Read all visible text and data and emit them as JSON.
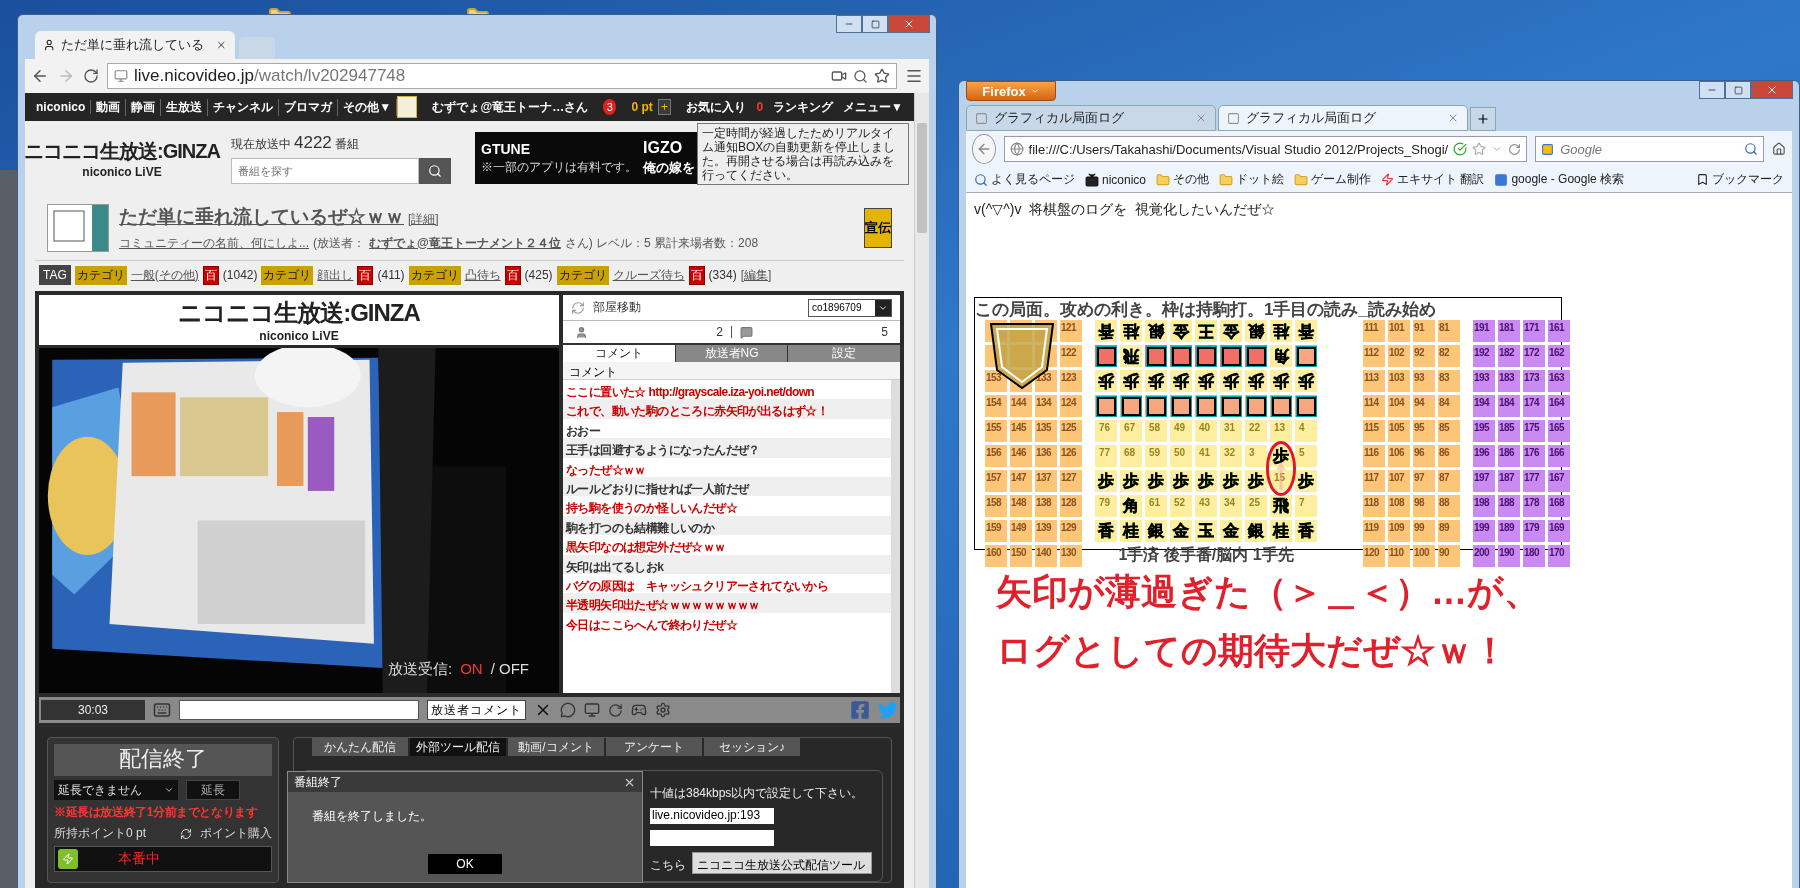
{
  "chrome": {
    "tab": {
      "title": "ただ単に垂れ流している"
    },
    "url": {
      "host": "live.nicovideo.jp",
      "path": "/watch/lv202947748"
    },
    "nav": {
      "links": [
        "niconico",
        "動画",
        "静画",
        "生放送",
        "チャンネル",
        "ブロマガ",
        "その他▼"
      ],
      "user": "むずでょ@竜王トーナ…さん",
      "notifications": "3",
      "points": "0 pt",
      "add": "+",
      "favorites": "お気に入り",
      "favorites_count": "0",
      "ranking": "ランキング",
      "menu": "メニュー▼"
    },
    "header": {
      "logo": "ニコニコ生放送:GINZA",
      "logo_sub": "niconico LiVE",
      "on_air_label": "現在放送中",
      "on_air_count": "4222",
      "on_air_unit": "番組",
      "search_placeholder": "番組を探す",
      "ad": {
        "brand": "GTUNE",
        "headline": "IGZO",
        "tagline": "俺の嫁を",
        "note": "※一部のアプリは有料です。"
      },
      "tooltip": "一定時間が経過したためリアルタイム通知BOXの自動更新を停止しました。再開させる場合は再読み込みを行ってください。"
    },
    "program": {
      "title": "ただ単に垂れ流しているぜ☆ｗｗ",
      "detail": "[詳細]",
      "community": "コミュニティーの名前、何にしよ...",
      "broadcaster_label": "(放送者：",
      "broadcaster": "むずでょ@竜王トーナメント２４位",
      "stats": "さん) レベル：5 累計来場者数：208",
      "promote": "宣伝"
    },
    "tags": {
      "label": "TAG",
      "items": [
        {
          "category": "カテゴリ",
          "name": "一般(その他)",
          "dict": "百",
          "count": "(1042)"
        },
        {
          "category": "カテゴリ",
          "name": "顔出し",
          "dict": "百",
          "count": "(411)"
        },
        {
          "category": "カテゴリ",
          "name": "凸待ち",
          "dict": "百",
          "count": "(425)"
        },
        {
          "category": "カテゴリ",
          "name": "クルーズ待ち",
          "dict": "百",
          "count": "(334)"
        }
      ],
      "edit": "[編集]"
    },
    "player": {
      "logo": "ニコニコ生放送:GINZA",
      "logo_sub": "niconico LiVE",
      "reception_label": "放送受信:",
      "reception_on": "ON",
      "reception_off": "/ OFF",
      "room_label": "部屋移動",
      "room": "co1896709",
      "viewers": "2",
      "comment_total": "5",
      "tabs": [
        {
          "label": "コメント",
          "selected": true
        },
        {
          "label": "放送者NG",
          "selected": false
        },
        {
          "label": "設定",
          "selected": false
        }
      ],
      "comment_header": "コメント",
      "comments": [
        {
          "text": "ここに置いた☆  http://grayscale.iza-yoi.net/down",
          "color": "#cc0000"
        },
        {
          "text": "これで、動いた駒のところに赤矢印が出るはず☆！",
          "color": "#cc0000"
        },
        {
          "text": "おおー",
          "color": "#333333"
        },
        {
          "text": "王手は回避するようになったんだぜ？",
          "color": "#333333"
        },
        {
          "text": "なったぜ☆ｗｗ",
          "color": "#cc0000"
        },
        {
          "text": "ルールどおりに指せれば一人前だぜ",
          "color": "#333333"
        },
        {
          "text": "持ち駒を使うのか怪しいんだぜ☆",
          "color": "#cc0000"
        },
        {
          "text": "駒を打つのも結構難しいのか",
          "color": "#333333"
        },
        {
          "text": "黒矢印なのは想定外だぜ☆ｗｗ",
          "color": "#cc0000"
        },
        {
          "text": "矢印は出てるしおk",
          "color": "#333333"
        },
        {
          "text": "バグの原因は　キャッシュクリアーされてないから",
          "color": "#cc0000"
        },
        {
          "text": "半透明矢印出たぜ☆ｗｗｗｗｗｗｗｗ",
          "color": "#cc0000"
        },
        {
          "text": "今日はここらへんで終わりだぜ☆",
          "color": "#cc0000"
        }
      ],
      "time": "30:03",
      "broadcaster_comment": "放送者コメント"
    },
    "broadcast": {
      "status": "配信終了",
      "extend_select": "延長できません",
      "extend_button": "延長",
      "notice": "※延長は放送終了1分前までとなります",
      "points": "所持ポイント0 pt",
      "buy": "ポイント購入",
      "live": "本番中",
      "tabs": [
        {
          "label": "かんたん配信",
          "selected": false
        },
        {
          "label": "外部ツール配信",
          "selected": true
        },
        {
          "label": "動画/コメント",
          "selected": false
        },
        {
          "label": "アンケート",
          "selected": false
        },
        {
          "label": "セッション♪",
          "selected": false
        }
      ],
      "bitrate_note": "十値は384kbps以内で設定して下さい。",
      "server": "live.nicovideo.jp:193",
      "link": "こちら",
      "tool": "ニコニコ生放送公式配信ツール"
    },
    "dialog": {
      "title": "番組終了",
      "message": "番組を終了しました。",
      "ok": "OK"
    }
  },
  "firefox": {
    "menu": "Firefox",
    "tabs": [
      {
        "title": "グラフィカル局面ログ",
        "selected": false
      },
      {
        "title": "グラフィカル局面ログ",
        "selected": true
      }
    ],
    "url": "file:///C:/Users/Takahashi/Documents/Visual Studio 2012/Projects_Shogi/",
    "search_placeholder": "Google",
    "bookmarks": [
      {
        "label": "よく見るページ",
        "kind": "page"
      },
      {
        "label": "niconico",
        "kind": "tv"
      },
      {
        "label": "その他",
        "kind": "folder"
      },
      {
        "label": "ドット絵",
        "kind": "folder"
      },
      {
        "label": "ゲーム制作",
        "kind": "folder"
      },
      {
        "label": "エキサイト 翻訳",
        "kind": "site"
      },
      {
        "label": "google - Google 検索",
        "kind": "google"
      }
    ],
    "bookmarks_menu": "ブックマーク",
    "intro": "v(^▽^)v  将棋盤のログを  視覚化したいんだぜ☆",
    "board": {
      "title": "この局面。攻めの利き。枠は持駒打。1手目の読み_読み始め",
      "left_hand": [
        [
          {
            "hidden": true
          },
          {
            "hidden": true
          },
          {
            "hidden": true
          },
          {
            "label": "121"
          }
        ],
        [
          {
            "hidden": true
          },
          {
            "hidden": true
          },
          {
            "hidden": true
          },
          {
            "label": "122"
          }
        ],
        [
          {
            "label": "153"
          },
          {
            "hidden": true
          },
          {
            "label": "133"
          },
          {
            "label": "123"
          }
        ],
        [
          {
            "label": "154"
          },
          {
            "label": "144"
          },
          {
            "label": "134"
          },
          {
            "label": "124"
          }
        ],
        [
          {
            "label": "155"
          },
          {
            "label": "145"
          },
          {
            "label": "135"
          },
          {
            "label": "125"
          }
        ],
        [
          {
            "label": "156"
          },
          {
            "label": "146"
          },
          {
            "label": "136"
          },
          {
            "label": "126"
          }
        ],
        [
          {
            "label": "157"
          },
          {
            "label": "147"
          },
          {
            "label": "137"
          },
          {
            "label": "127"
          }
        ],
        [
          {
            "label": "158"
          },
          {
            "label": "148"
          },
          {
            "label": "138"
          },
          {
            "label": "128"
          }
        ],
        [
          {
            "label": "159"
          },
          {
            "label": "149"
          },
          {
            "label": "139"
          },
          {
            "label": "129"
          }
        ],
        [
          {
            "label": "160"
          },
          {
            "label": "150"
          },
          {
            "label": "140"
          },
          {
            "label": "130"
          }
        ]
      ],
      "squares": [
        [
          {
            "kind": "enemy",
            "text": "香"
          },
          {
            "kind": "enemy",
            "text": "桂"
          },
          {
            "kind": "enemy",
            "text": "銀"
          },
          {
            "kind": "enemy",
            "text": "金"
          },
          {
            "kind": "enemy",
            "text": "王"
          },
          {
            "kind": "enemy",
            "text": "金"
          },
          {
            "kind": "enemy",
            "text": "銀"
          },
          {
            "kind": "enemy",
            "text": "桂"
          },
          {
            "kind": "enemy",
            "text": "香"
          }
        ],
        [
          {
            "kind": "box",
            "color": "#f07068"
          },
          {
            "kind": "enemy",
            "text": "飛"
          },
          {
            "kind": "box",
            "color": "#f07068"
          },
          {
            "kind": "box",
            "color": "#f07068"
          },
          {
            "kind": "box",
            "color": "#f07068"
          },
          {
            "kind": "box",
            "color": "#f07068"
          },
          {
            "kind": "box",
            "color": "#f07068"
          },
          {
            "kind": "enemy",
            "text": "角"
          },
          {
            "kind": "box",
            "color": "#f5a880"
          }
        ],
        [
          {
            "kind": "enemy",
            "text": "歩"
          },
          {
            "kind": "enemy",
            "text": "歩"
          },
          {
            "kind": "enemy",
            "text": "歩"
          },
          {
            "kind": "enemy",
            "text": "歩"
          },
          {
            "kind": "enemy",
            "text": "歩"
          },
          {
            "kind": "enemy",
            "text": "歩"
          },
          {
            "kind": "enemy",
            "text": "歩"
          },
          {
            "kind": "enemy",
            "text": "歩"
          },
          {
            "kind": "enemy",
            "text": "歩"
          }
        ],
        [
          {
            "kind": "box",
            "color": "#f5a880"
          },
          {
            "kind": "box",
            "color": "#f5a880"
          },
          {
            "kind": "box",
            "color": "#f5a880"
          },
          {
            "kind": "box",
            "color": "#f5a880"
          },
          {
            "kind": "box",
            "color": "#f5a880"
          },
          {
            "kind": "box",
            "color": "#f5a880"
          },
          {
            "kind": "box",
            "color": "#f5a880"
          },
          {
            "kind": "box",
            "color": "#f5a880"
          },
          {
            "kind": "box",
            "color": "#f5a880"
          }
        ],
        [
          {
            "kind": "num",
            "text": "76"
          },
          {
            "kind": "num",
            "text": "67"
          },
          {
            "kind": "num",
            "text": "58"
          },
          {
            "kind": "num",
            "text": "49"
          },
          {
            "kind": "num",
            "text": "40"
          },
          {
            "kind": "num",
            "text": "31"
          },
          {
            "kind": "num",
            "text": "22"
          },
          {
            "kind": "num",
            "text": "13"
          },
          {
            "kind": "num",
            "text": "4"
          }
        ],
        [
          {
            "kind": "num",
            "text": "77"
          },
          {
            "kind": "num",
            "text": "68"
          },
          {
            "kind": "num",
            "text": "59"
          },
          {
            "kind": "num",
            "text": "50"
          },
          {
            "kind": "num",
            "text": "41"
          },
          {
            "kind": "num",
            "text": "32"
          },
          {
            "kind": "num",
            "text": "3"
          },
          {
            "kind": "own",
            "text": "歩"
          },
          {
            "kind": "num",
            "text": "5"
          }
        ],
        [
          {
            "kind": "own",
            "text": "歩"
          },
          {
            "kind": "own",
            "text": "歩"
          },
          {
            "kind": "own",
            "text": "歩"
          },
          {
            "kind": "own",
            "text": "歩"
          },
          {
            "kind": "own",
            "text": "歩"
          },
          {
            "kind": "own",
            "text": "歩"
          },
          {
            "kind": "own",
            "text": "歩"
          },
          {
            "kind": "num",
            "text": "15"
          },
          {
            "kind": "own",
            "text": "歩"
          }
        ],
        [
          {
            "kind": "num",
            "text": "79"
          },
          {
            "kind": "own",
            "text": "角"
          },
          {
            "kind": "num",
            "text": "61"
          },
          {
            "kind": "num",
            "text": "52"
          },
          {
            "kind": "num",
            "text": "43"
          },
          {
            "kind": "num",
            "text": "34"
          },
          {
            "kind": "num",
            "text": "25"
          },
          {
            "kind": "own",
            "text": "飛"
          },
          {
            "kind": "num",
            "text": "7"
          }
        ],
        [
          {
            "kind": "own",
            "text": "香"
          },
          {
            "kind": "own",
            "text": "桂"
          },
          {
            "kind": "own",
            "text": "銀"
          },
          {
            "kind": "own",
            "text": "金"
          },
          {
            "kind": "own",
            "text": "玉"
          },
          {
            "kind": "own",
            "text": "金"
          },
          {
            "kind": "own",
            "text": "銀"
          },
          {
            "kind": "own",
            "text": "桂"
          },
          {
            "kind": "own",
            "text": "香"
          }
        ]
      ],
      "caption": "1手済 後手番/脳内 1手先",
      "right_hand": [
        [
          "111",
          "101",
          "91",
          "81"
        ],
        [
          "112",
          "102",
          "92",
          "82"
        ],
        [
          "113",
          "103",
          "93",
          "83"
        ],
        [
          "114",
          "104",
          "94",
          "84"
        ],
        [
          "115",
          "105",
          "95",
          "85"
        ],
        [
          "116",
          "106",
          "96",
          "86"
        ],
        [
          "117",
          "107",
          "97",
          "87"
        ],
        [
          "118",
          "108",
          "98",
          "88"
        ],
        [
          "119",
          "109",
          "99",
          "89"
        ],
        [
          "120",
          "110",
          "100",
          "90"
        ]
      ],
      "far_hand": [
        [
          "191",
          "181",
          "171",
          "161"
        ],
        [
          "192",
          "182",
          "172",
          "162"
        ],
        [
          "193",
          "183",
          "173",
          "163"
        ],
        [
          "194",
          "184",
          "174",
          "164"
        ],
        [
          "195",
          "185",
          "175",
          "165"
        ],
        [
          "196",
          "186",
          "176",
          "166"
        ],
        [
          "197",
          "187",
          "177",
          "167"
        ],
        [
          "198",
          "188",
          "178",
          "168"
        ],
        [
          "199",
          "189",
          "179",
          "169"
        ],
        [
          "200",
          "190",
          "180",
          "170"
        ]
      ]
    },
    "comment_lines": [
      "矢印が薄過ぎた（＞＿＜）…が、",
      "ログとしての期待大だぜ☆ｗ！"
    ]
  }
}
